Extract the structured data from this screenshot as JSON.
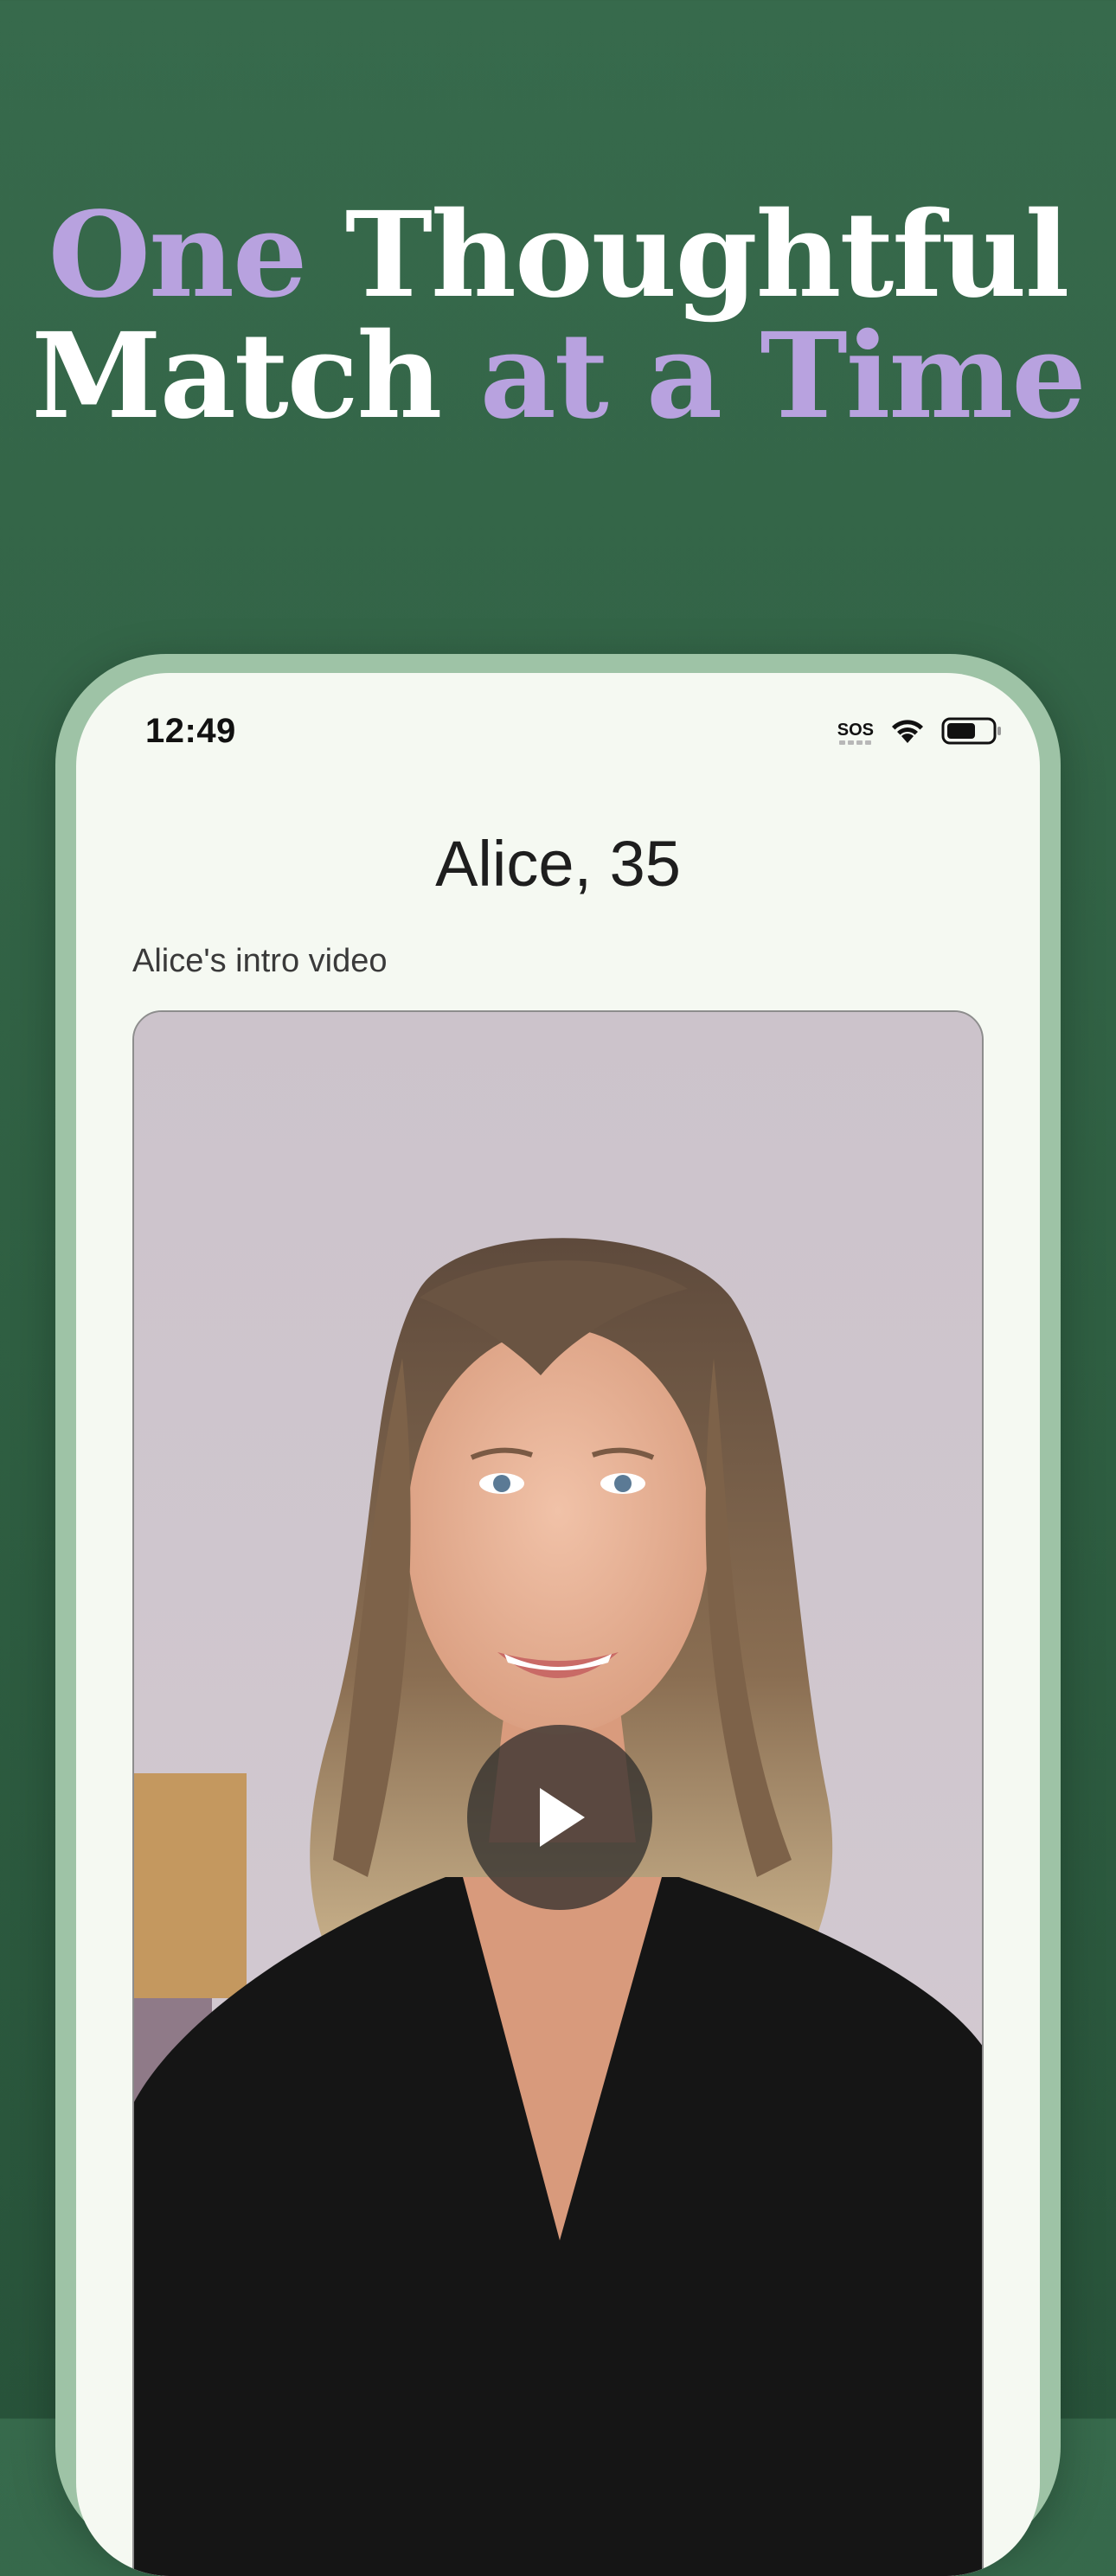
{
  "headline": {
    "line1_accent": "One",
    "line1_rest": "Thoughtful",
    "line2_start": "Match",
    "line2_accent": "at a Time"
  },
  "colors": {
    "background": "#376a4c",
    "accent": "#b8a2df",
    "frame": "#9ec3a6",
    "screen": "#f5f9f2"
  },
  "status_bar": {
    "time": "12:49",
    "sos": "SOS",
    "icons": [
      "wifi-icon",
      "battery-icon"
    ]
  },
  "profile": {
    "title": "Alice, 35",
    "video_label": "Alice's intro video",
    "video_icon": "play-icon"
  }
}
